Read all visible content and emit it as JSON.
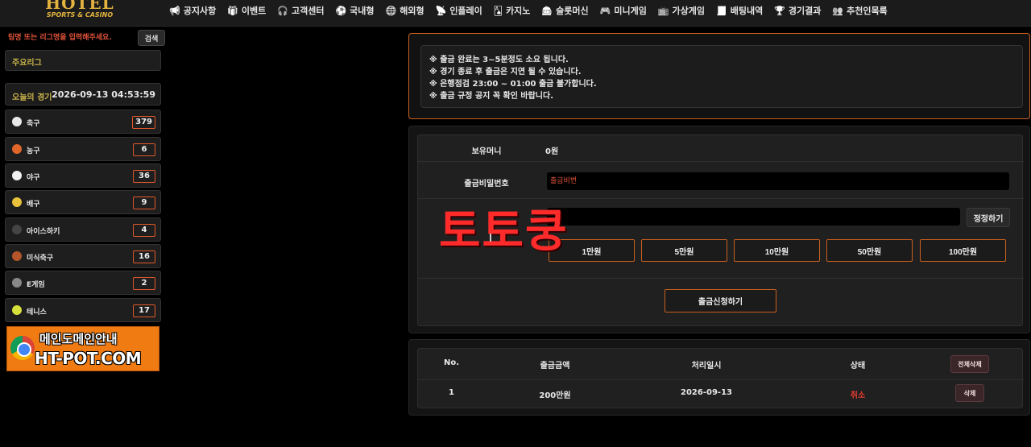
{
  "logo": {
    "title": "HOTEL",
    "subtitle": "SPORTS & CASINO"
  },
  "nav": [
    {
      "label": "공지사항",
      "icon": "megaphone-icon",
      "glyph": "📢"
    },
    {
      "label": "이벤트",
      "icon": "gift-icon",
      "glyph": "🎁"
    },
    {
      "label": "고객센터",
      "icon": "headset-icon",
      "glyph": "🎧"
    },
    {
      "label": "국내형",
      "icon": "soccer-icon",
      "glyph": "⚽"
    },
    {
      "label": "해외형",
      "icon": "globe-icon",
      "glyph": "🌐"
    },
    {
      "label": "인플레이",
      "icon": "broadcast-icon",
      "glyph": "📡"
    },
    {
      "label": "카지노",
      "icon": "card-icon",
      "glyph": "🂡"
    },
    {
      "label": "슬롯머신",
      "icon": "slot-icon",
      "glyph": "🎰"
    },
    {
      "label": "미니게임",
      "icon": "gamepad-icon",
      "glyph": "🎮"
    },
    {
      "label": "가상게임",
      "icon": "tv-icon",
      "glyph": "📺"
    },
    {
      "label": "배팅내역",
      "icon": "receipt-icon",
      "glyph": "🧾"
    },
    {
      "label": "경기결과",
      "icon": "trophy-icon",
      "glyph": "🏆"
    },
    {
      "label": "추천인목록",
      "icon": "users-icon",
      "glyph": "👥"
    }
  ],
  "sidebar": {
    "search_placeholder": "팀명 또는 리그명을 입력해주세요.",
    "search_button": "검색",
    "major_league": "주요리그",
    "today_label": "오늘의 경기",
    "today_time": "2026-09-13 04:53:59",
    "sports": [
      {
        "name": "축구",
        "count": "379",
        "icon": "soccer-ball-icon",
        "color": "#e8e8e8"
      },
      {
        "name": "농구",
        "count": "6",
        "icon": "basketball-icon",
        "color": "#e0662a"
      },
      {
        "name": "야구",
        "count": "36",
        "icon": "baseball-icon",
        "color": "#f2f2f2"
      },
      {
        "name": "배구",
        "count": "9",
        "icon": "volleyball-icon",
        "color": "#e8c23a"
      },
      {
        "name": "아이스하키",
        "count": "4",
        "icon": "hockey-puck-icon",
        "color": "#444444"
      },
      {
        "name": "미식축구",
        "count": "16",
        "icon": "football-icon",
        "color": "#b4552a"
      },
      {
        "name": "E게임",
        "count": "2",
        "icon": "gamepad-icon",
        "color": "#888888"
      },
      {
        "name": "테니스",
        "count": "17",
        "icon": "tennis-ball-icon",
        "color": "#d6e23a"
      }
    ],
    "banner": {
      "line1": "메인도메인안내",
      "line2": "HT-POT.COM"
    }
  },
  "notice": [
    "※ 출금 완료는 3~5분정도 소요 됩니다.",
    "※ 경기 종료 후 출금은 지연 될 수 있습니다.",
    "※ 은행점검 23:00 ~ 01:00 출금 불가합니다.",
    "※ 출금 규정 공지 꼭 확인 바랍니다."
  ],
  "form": {
    "balance_label": "보유머니",
    "balance_value": "0원",
    "password_label": "출금비밀번호",
    "password_placeholder": "출금비번",
    "reset_button": "정정하기",
    "quick_amounts": [
      "1만원",
      "5만원",
      "10만원",
      "50만원",
      "100만원"
    ],
    "submit_button": "출금신청하기"
  },
  "watermark": "토토쿵",
  "history": {
    "headers": {
      "no": "No.",
      "amount": "출금금액",
      "date": "처리일시",
      "status": "상태"
    },
    "delete_all": "전체삭제",
    "rows": [
      {
        "no": "1",
        "amount": "200만원",
        "date": "2026-09-13",
        "status": "취소",
        "delete": "삭제"
      }
    ]
  }
}
